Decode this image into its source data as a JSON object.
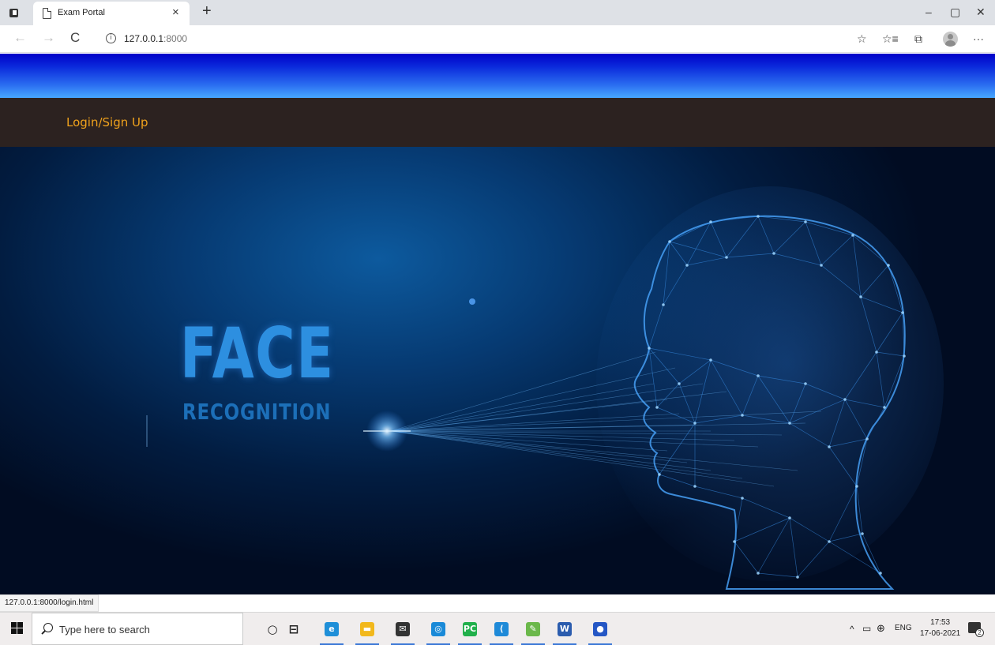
{
  "browser": {
    "tab_title": "Exam Portal",
    "tab_close": "×",
    "new_tab": "+",
    "window_controls": {
      "minimize": "–",
      "restore": "▢",
      "close": "✕"
    },
    "nav": {
      "back": "←",
      "forward": "→",
      "refresh": "C"
    },
    "address": {
      "info": "i",
      "host": "127.0.0.1",
      "port": ":8000"
    },
    "toolbar_icons": {
      "favorite_add": "☆",
      "favorites": "☆≡",
      "collections": "⧉",
      "more": "···"
    },
    "status_url": "127.0.0.1:8000/login.html"
  },
  "page": {
    "nav_link": "Login/Sign Up",
    "hero": {
      "title": "FACE",
      "subtitle": "RECOGNITION"
    },
    "colors": {
      "header_top": "#0000c8",
      "header_bottom": "#47a8ff",
      "navbar": "#2c2220",
      "link": "#f0a21c",
      "hero_bg": "#021c40",
      "hero_text": "#2d8fe0"
    }
  },
  "taskbar": {
    "search_placeholder": "Type here to search",
    "apps": [
      {
        "icon": "cortana-icon",
        "glyph": "○"
      },
      {
        "icon": "task-view-icon",
        "glyph": "⊟"
      },
      {
        "icon": "edge-icon",
        "glyph": "e",
        "color": "#1f8fd8"
      },
      {
        "icon": "file-explorer-icon",
        "glyph": "▬",
        "color": "#f2b81c"
      },
      {
        "icon": "mail-icon",
        "glyph": "✉",
        "color": "#333333"
      },
      {
        "icon": "dell-icon",
        "glyph": "◎",
        "color": "#1a8ad8"
      },
      {
        "icon": "pycharm-icon",
        "glyph": "PC",
        "color": "#21b04b"
      },
      {
        "icon": "vscode-icon",
        "glyph": "⟨",
        "color": "#1f8ad8"
      },
      {
        "icon": "image-app-icon",
        "glyph": "✎",
        "color": "#6bb84a"
      },
      {
        "icon": "word-icon",
        "glyph": "W",
        "color": "#2b5cae"
      },
      {
        "icon": "app-icon",
        "glyph": "●",
        "color": "#2557c5"
      }
    ],
    "tray": {
      "chevron": "^",
      "lang": "ENG",
      "time": "17:53",
      "date": "17-06-2021",
      "notifications": "2"
    }
  }
}
